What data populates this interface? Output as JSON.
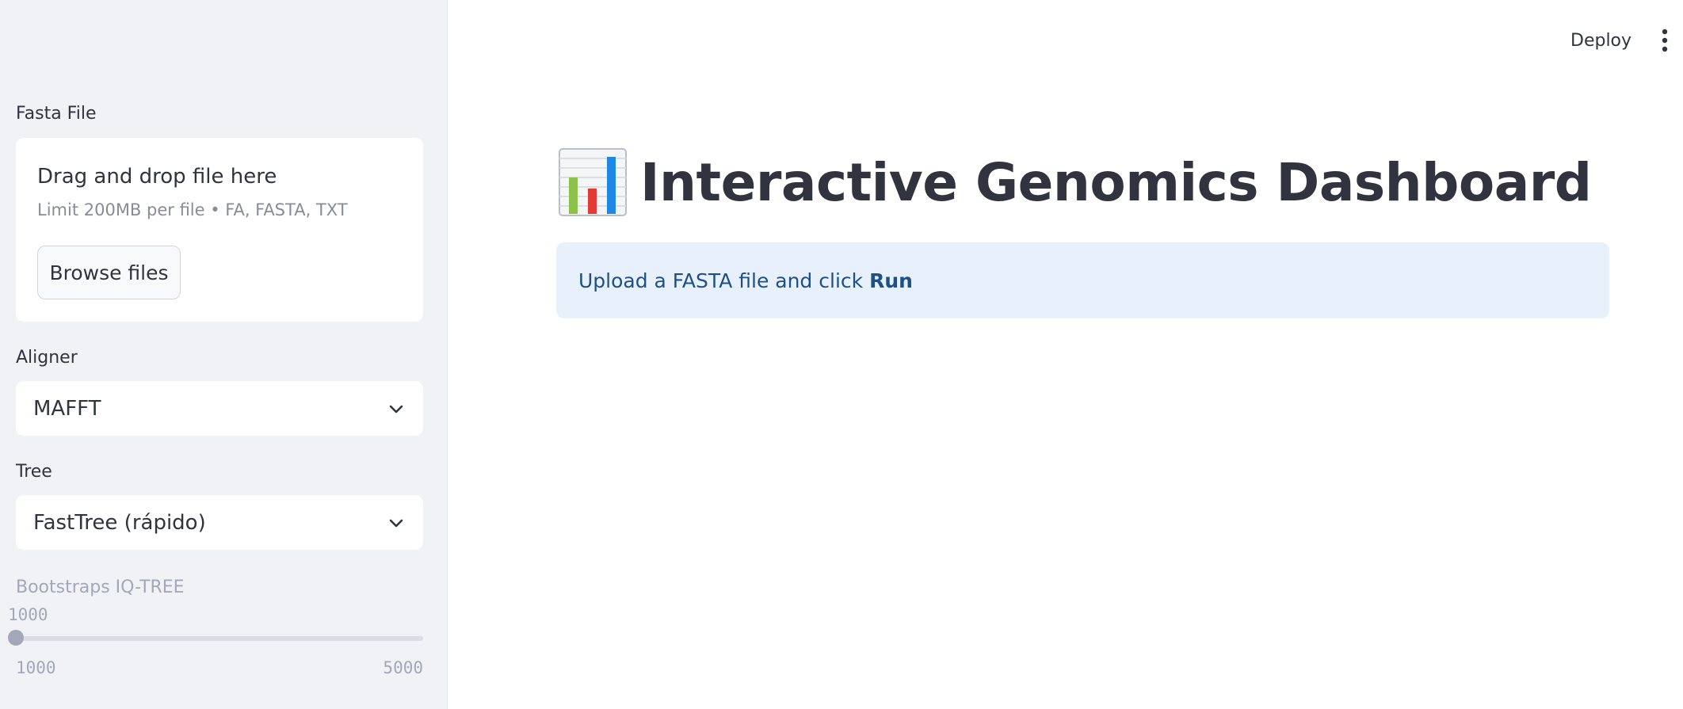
{
  "sidebar": {
    "fasta_label": "Fasta File",
    "uploader": {
      "title": "Drag and drop file here",
      "limit": "Limit 200MB per file • FA, FASTA, TXT",
      "browse_label": "Browse files"
    },
    "aligner": {
      "label": "Aligner",
      "value": "MAFFT"
    },
    "tree": {
      "label": "Tree",
      "value": "FastTree (rápido)"
    },
    "bootstraps": {
      "label": "Bootstraps IQ-TREE",
      "value": "1000",
      "min": "1000",
      "max": "5000",
      "fraction": 0
    }
  },
  "header": {
    "deploy_label": "Deploy",
    "menu_icon": "kebab-menu-icon"
  },
  "main": {
    "title_icon": "bar-chart-icon",
    "title": "Interactive Genomics Dashboard",
    "info_text": "Upload a FASTA file and click",
    "info_bold": "Run"
  },
  "colors": {
    "sidebar_bg": "#f0f2f6",
    "info_bg": "#e8f1fb",
    "info_text": "#1e4f86",
    "text": "#31333f",
    "disabled": "#a3a8b8"
  }
}
